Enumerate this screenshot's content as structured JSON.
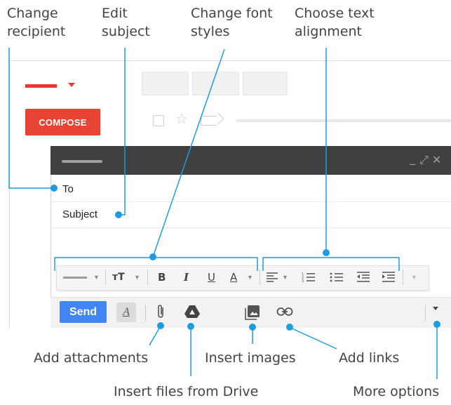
{
  "callouts": {
    "change_recipient": "Change recipient",
    "edit_subject": "Edit subject",
    "change_font_styles": "Change font styles",
    "choose_text_alignment": "Choose text alignment",
    "add_attachments": "Add attachments",
    "insert_images": "Insert images",
    "add_links": "Add links",
    "insert_files_from_drive": "Insert files from Drive",
    "more_options": "More options"
  },
  "sidebar": {
    "compose_label": "COMPOSE"
  },
  "compose": {
    "to_label": "To",
    "subject_label": "Subject",
    "send_label": "Send"
  },
  "toolbar": {
    "font_size_glyph": "тT",
    "bold_glyph": "B",
    "italic_glyph": "I",
    "underline_glyph": "U",
    "text_color_glyph": "A"
  },
  "bottom": {
    "formatting_glyph": "A"
  },
  "colors": {
    "accent": "#1e9ce0",
    "compose_button": "#e84335",
    "send_button": "#4285f4",
    "header": "#404040"
  },
  "icons": [
    "minimize-icon",
    "expand-icon",
    "close-icon",
    "attach-icon",
    "drive-icon",
    "image-icon",
    "link-icon",
    "more-options-icon",
    "align-left-icon",
    "numbered-list-icon",
    "bulleted-list-icon",
    "indent-less-icon",
    "indent-more-icon",
    "star-icon",
    "label-icon",
    "checkbox-icon"
  ]
}
